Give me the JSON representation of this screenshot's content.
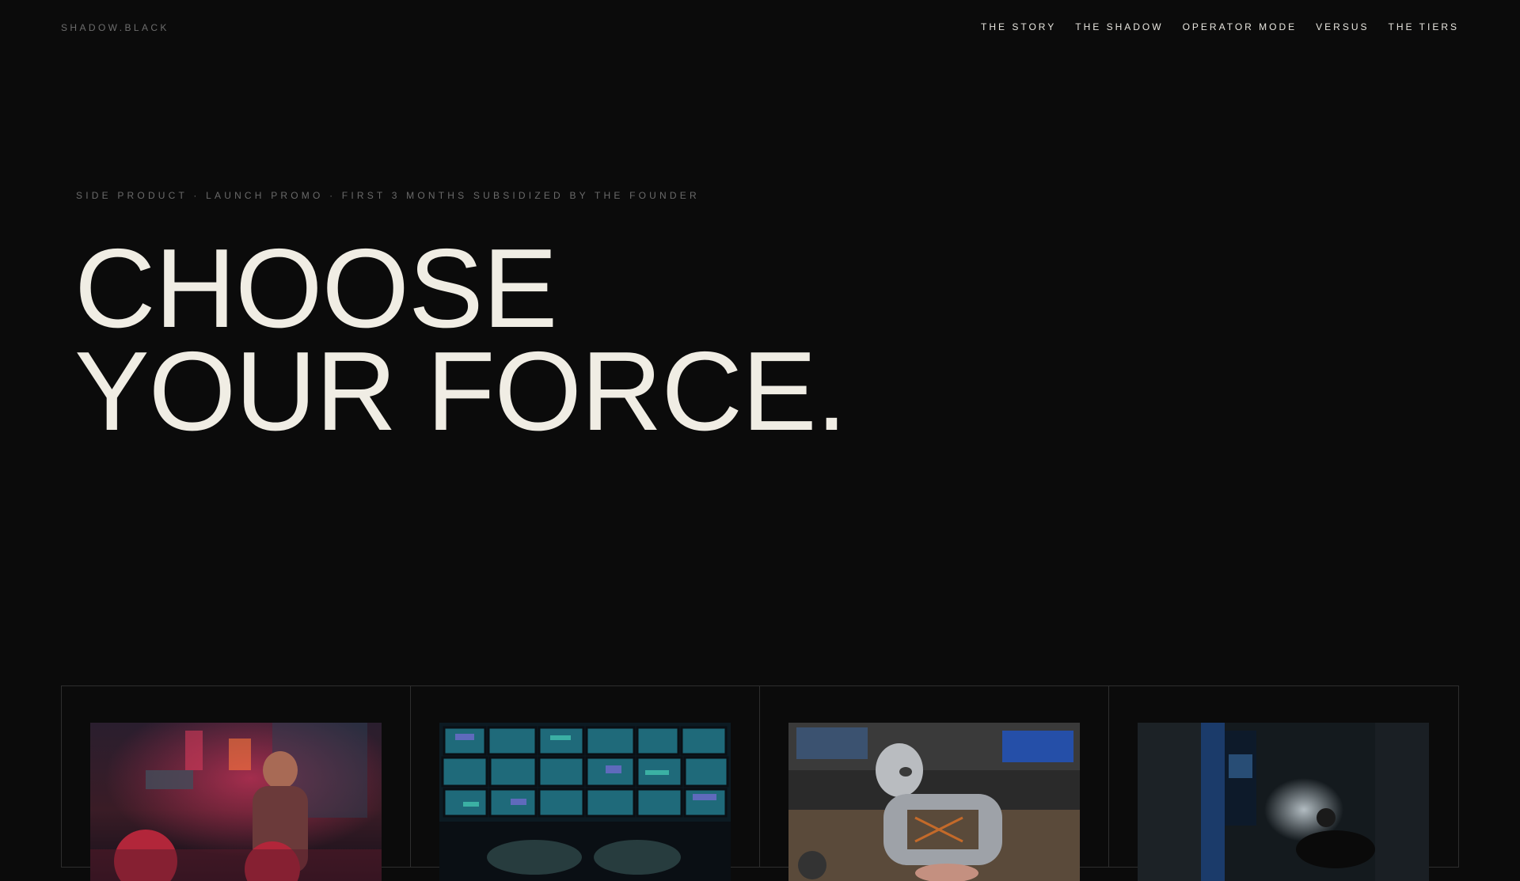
{
  "brand": "SHADOW.BLACK",
  "nav": [
    "THE STORY",
    "THE SHADOW",
    "OPERATOR MODE",
    "VERSUS",
    "THE TIERS"
  ],
  "eyebrow": "SIDE PRODUCT · LAUNCH PROMO · FIRST 3 MONTHS SUBSIDIZED BY THE FOUNDER",
  "headline": {
    "line1": "CHOOSE",
    "line2": "YOUR FORCE."
  },
  "cards": [
    {
      "image": "boxer-neon-street-image"
    },
    {
      "image": "monitor-wall-image"
    },
    {
      "image": "robot-workshop-image"
    },
    {
      "image": "dark-corridor-flashlight-image"
    }
  ]
}
